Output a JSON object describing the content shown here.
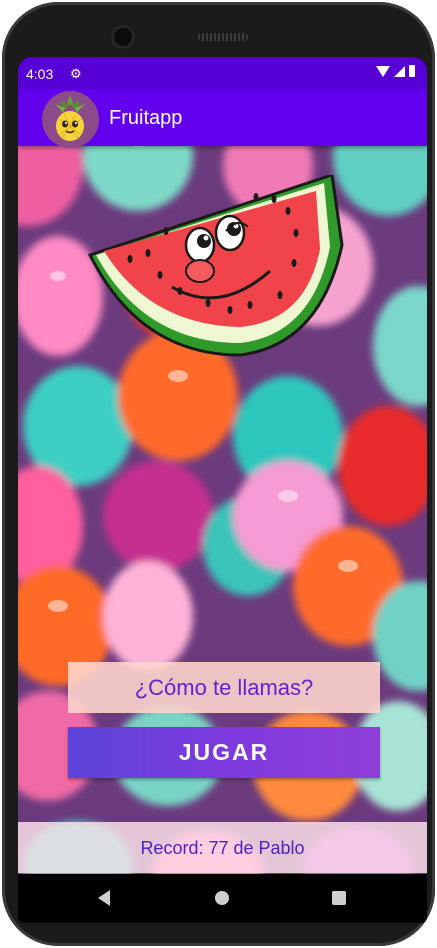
{
  "status_bar": {
    "time": "4:03",
    "icons": [
      "gear-icon",
      "wifi-icon",
      "signal-icon",
      "battery-icon"
    ]
  },
  "app_bar": {
    "title": "Fruitapp",
    "logo_icon": "pineapple-logo"
  },
  "main": {
    "mascot_icon": "watermelon-mascot",
    "name_input": {
      "placeholder": "¿Cómo te llamas?",
      "value": ""
    },
    "play_button": {
      "label": "JUGAR"
    },
    "record_text": "Record: 77 de Pablo"
  },
  "nav_bar": {
    "icons": [
      "back-icon",
      "home-icon",
      "recents-icon"
    ]
  },
  "colors": {
    "status_bar": "#5600d6",
    "app_bar": "#6200ee",
    "accent_text": "#6a1fd0"
  }
}
